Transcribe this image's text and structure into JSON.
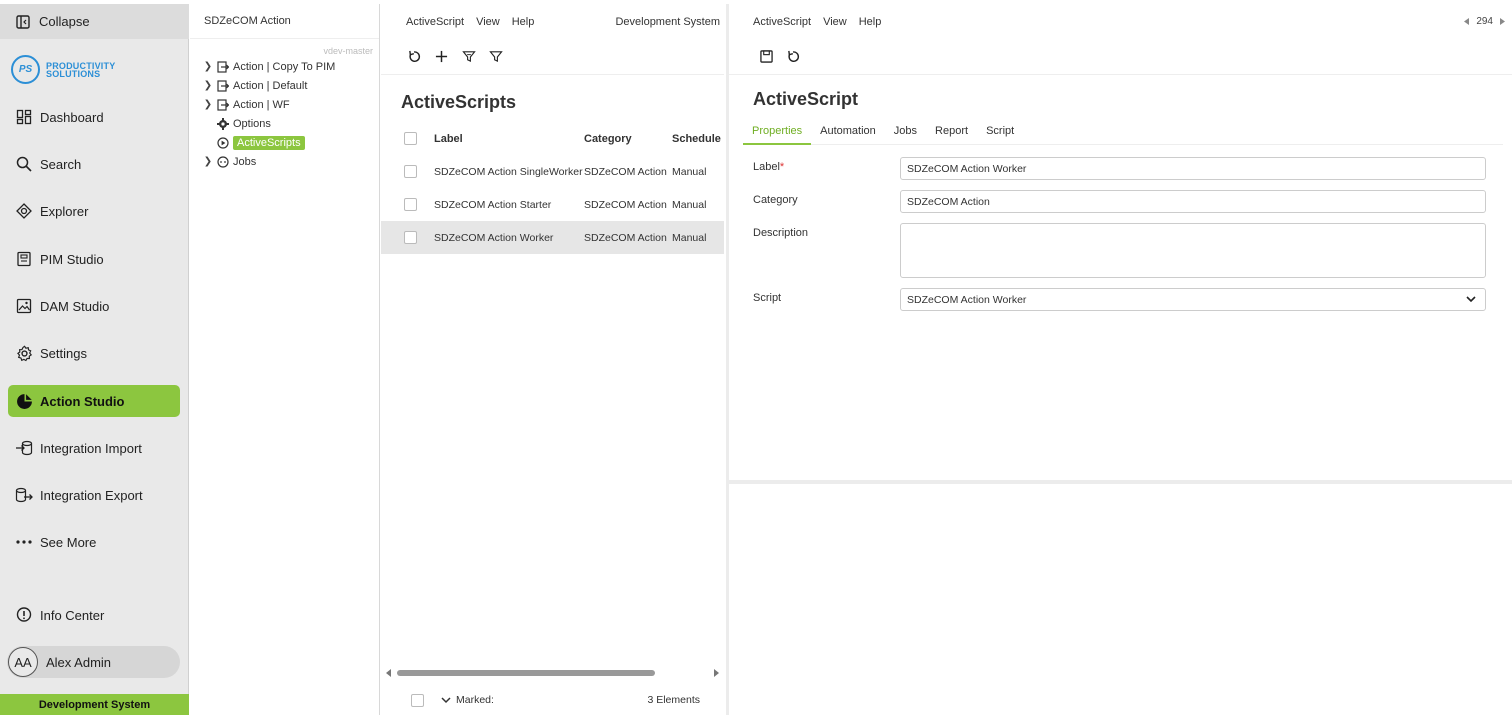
{
  "nav": {
    "collapse_label": "Collapse",
    "logo": {
      "mark": "PS",
      "line1": "PRODUCTIVITY",
      "line2": "SOLUTIONS"
    },
    "items": [
      {
        "label": "Dashboard",
        "icon": "dashboard-icon"
      },
      {
        "label": "Search",
        "icon": "search-icon"
      },
      {
        "label": "Explorer",
        "icon": "explorer-icon"
      },
      {
        "label": "PIM Studio",
        "icon": "pim-studio-icon"
      },
      {
        "label": "DAM Studio",
        "icon": "image-icon"
      },
      {
        "label": "Settings",
        "icon": "gear-icon"
      },
      {
        "label": "Action Studio",
        "icon": "action-studio-icon",
        "active": true
      },
      {
        "label": "Integration Import",
        "icon": "import-icon"
      },
      {
        "label": "Integration Export",
        "icon": "export-icon"
      },
      {
        "label": "See More",
        "icon": "more-icon"
      },
      {
        "label": "Info Center",
        "icon": "info-icon"
      }
    ],
    "user": {
      "initials": "AA",
      "name": "Alex Admin"
    },
    "environment": "Development System",
    "accent_color": "#8cc63f"
  },
  "tree": {
    "title": "SDZeCOM Action",
    "branch": "vdev-master",
    "nodes": [
      {
        "label": "Action | Copy To PIM",
        "icon": "action-icon",
        "expandable": true
      },
      {
        "label": "Action | Default",
        "icon": "action-icon",
        "expandable": true
      },
      {
        "label": "Action | WF",
        "icon": "action-icon",
        "expandable": true
      },
      {
        "label": "Options",
        "icon": "gear-icon",
        "expandable": false
      },
      {
        "label": "ActiveScripts",
        "icon": "play-circle-icon",
        "expandable": false,
        "selected": true
      },
      {
        "label": "Jobs",
        "icon": "jobs-icon",
        "expandable": true
      }
    ]
  },
  "list": {
    "menu": [
      "ActiveScript",
      "View",
      "Help"
    ],
    "system": "Development System",
    "title": "ActiveScripts",
    "columns": [
      "Label",
      "Category",
      "Schedule"
    ],
    "rows": [
      {
        "label": "SDZeCOM Action SingleWorker",
        "category": "SDZeCOM Action",
        "schedule": "Manual"
      },
      {
        "label": "SDZeCOM Action Starter",
        "category": "SDZeCOM Action",
        "schedule": "Manual"
      },
      {
        "label": "SDZeCOM Action Worker",
        "category": "SDZeCOM Action",
        "schedule": "Manual",
        "selected": true
      }
    ],
    "footer": {
      "marked_label": "Marked:",
      "count": "3 Elements"
    }
  },
  "detail": {
    "menu": [
      "ActiveScript",
      "View",
      "Help"
    ],
    "page_number": "294",
    "title": "ActiveScript",
    "tabs": [
      "Properties",
      "Automation",
      "Jobs",
      "Report",
      "Script"
    ],
    "active_tab": "Properties",
    "fields": {
      "label": {
        "label": "Label",
        "required_mark": "*",
        "value": "SDZeCOM Action Worker"
      },
      "category": {
        "label": "Category",
        "value": "SDZeCOM Action"
      },
      "description": {
        "label": "Description",
        "value": ""
      },
      "script": {
        "label": "Script",
        "value": "SDZeCOM Action Worker"
      }
    }
  }
}
